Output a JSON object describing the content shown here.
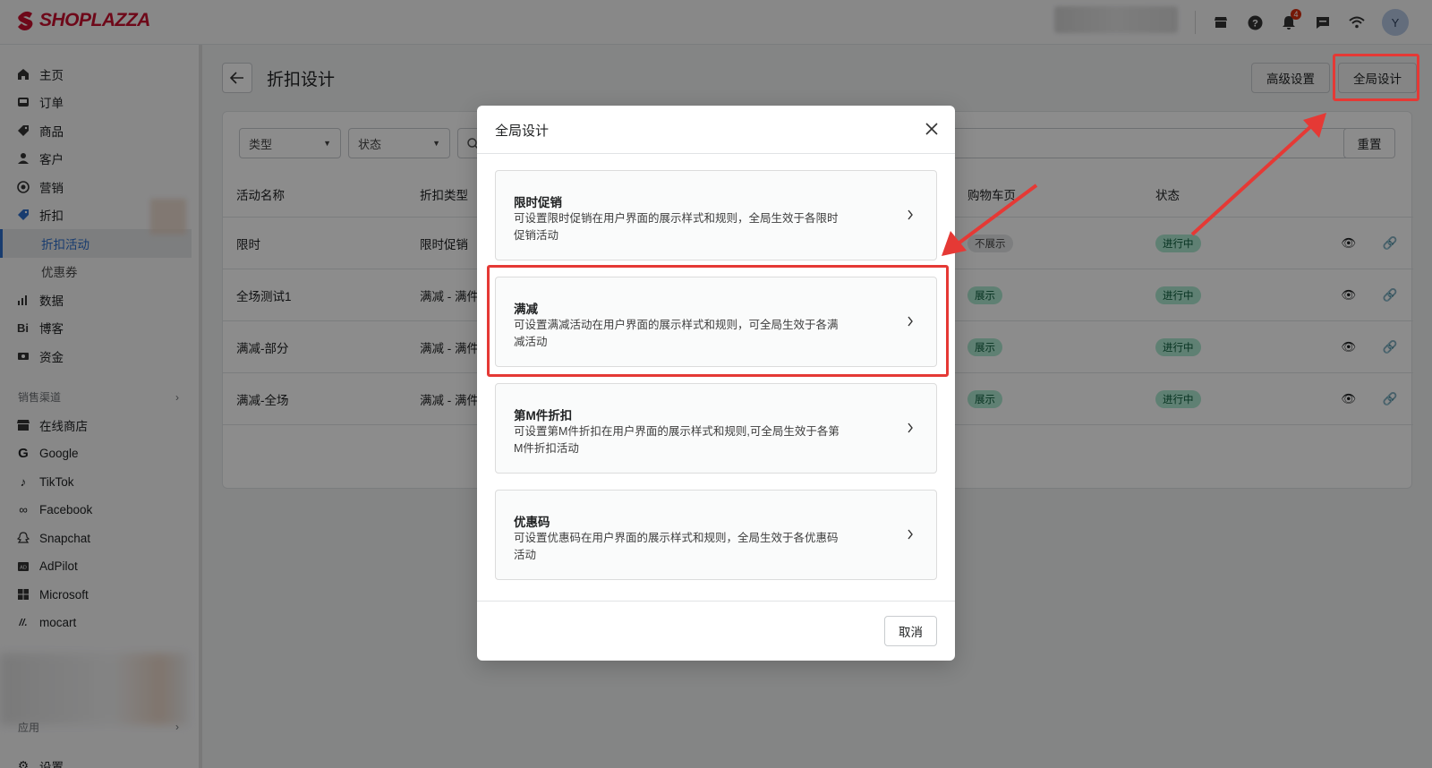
{
  "brand": {
    "name": "SHOPLAZZA",
    "color": "#c8102e"
  },
  "topbar": {
    "icons": [
      "store-icon",
      "help-icon",
      "bell-icon",
      "message-icon",
      "wifi-icon"
    ],
    "notification_count": "4",
    "avatar_letter": "Y"
  },
  "sidebar": {
    "items": [
      {
        "label": "主页",
        "icon": "home-icon"
      },
      {
        "label": "订单",
        "icon": "inbox-icon"
      },
      {
        "label": "商品",
        "icon": "tag-icon"
      },
      {
        "label": "客户",
        "icon": "person-icon"
      },
      {
        "label": "营销",
        "icon": "target-icon"
      },
      {
        "label": "折扣",
        "icon": "discount-icon"
      }
    ],
    "sub_items": [
      "折扣活动",
      "优惠券"
    ],
    "items2": [
      {
        "label": "数据",
        "icon": "bar-chart-icon"
      },
      {
        "label": "博客",
        "icon": "blog-icon"
      },
      {
        "label": "资金",
        "icon": "finance-icon"
      }
    ],
    "sales_channels_label": "销售渠道",
    "channels": [
      {
        "label": "在线商店",
        "icon": "store-icon"
      },
      {
        "label": "Google",
        "icon": "google-icon"
      },
      {
        "label": "TikTok",
        "icon": "tiktok-icon"
      },
      {
        "label": "Facebook",
        "icon": "meta-icon"
      },
      {
        "label": "Snapchat",
        "icon": "snapchat-icon"
      },
      {
        "label": "AdPilot",
        "icon": "adpilot-icon"
      },
      {
        "label": "Microsoft",
        "icon": "microsoft-icon"
      },
      {
        "label": "mocart",
        "icon": "mocart-icon"
      }
    ],
    "apps_label": "应用",
    "settings_label": "设置"
  },
  "page": {
    "title": "折扣设计",
    "advanced_button": "高级设置",
    "global_button": "全局设计"
  },
  "filters": {
    "type": "类型",
    "status": "状态",
    "reset": "重置"
  },
  "table": {
    "headers": [
      "活动名称",
      "折扣类型",
      "购物车页",
      "状态"
    ],
    "rows": [
      {
        "name": "限时",
        "type": "限时促销",
        "cart": "不展示",
        "cart_style": "gray",
        "status": "进行中"
      },
      {
        "name": "全场测试1",
        "type": "满减 - 满件",
        "cart": "展示",
        "cart_style": "green",
        "status": "进行中"
      },
      {
        "name": "满减-部分",
        "type": "满减 - 满件",
        "cart": "展示",
        "cart_style": "green",
        "status": "进行中"
      },
      {
        "name": "满减-全场",
        "type": "满减 - 满件",
        "cart": "展示",
        "cart_style": "green",
        "status": "进行中"
      }
    ]
  },
  "modal": {
    "title": "全局设计",
    "options": [
      {
        "title": "限时促销",
        "desc": "可设置限时促销在用户界面的展示样式和规则，全局生效于各限时促销活动"
      },
      {
        "title": "满减",
        "desc": "可设置满减活动在用户界面的展示样式和规则，可全局生效于各满减活动"
      },
      {
        "title": "第M件折扣",
        "desc": "可设置第M件折扣在用户界面的展示样式和规则,可全局生效于各第M件折扣活动"
      },
      {
        "title": "优惠码",
        "desc": "可设置优惠码在用户界面的展示样式和规则，全局生效于各优惠码活动"
      }
    ],
    "cancel": "取消"
  },
  "annotation_color": "#e53935"
}
